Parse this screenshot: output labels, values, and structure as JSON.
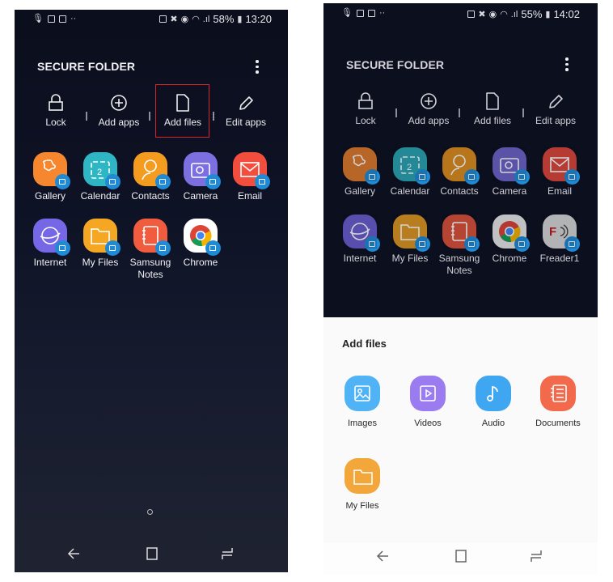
{
  "left_screen": {
    "status_bar": {
      "left_icons": [
        "mic-icon",
        "image-icon",
        "image-icon",
        "more-notifications-icon"
      ],
      "right_icons": [
        "battery-saver-icon",
        "mute-icon",
        "alarm-icon",
        "wifi-icon",
        "signal-icon"
      ],
      "battery": "58%",
      "time": "13:20"
    },
    "header": {
      "title": "SECURE FOLDER",
      "menu_icon": "more-vert-icon"
    },
    "actions": [
      {
        "label": "Lock",
        "icon": "lock-icon"
      },
      {
        "label": "Add apps",
        "icon": "add-circle-icon"
      },
      {
        "label": "Add files",
        "icon": "file-icon",
        "highlighted": true,
        "highlight_color": "#d7262a"
      },
      {
        "label": "Edit apps",
        "icon": "pencil-icon"
      }
    ],
    "apps": [
      {
        "label": "Gallery",
        "color": "#f7872f"
      },
      {
        "label": "Calendar",
        "color": "#2fb6c4"
      },
      {
        "label": "Contacts",
        "color": "#f39c1f"
      },
      {
        "label": "Camera",
        "color": "#7c6fe0"
      },
      {
        "label": "Email",
        "color": "#f24d3d"
      },
      {
        "label": "Internet",
        "color": "#7667e6"
      },
      {
        "label": "My Files",
        "color": "#f5a623"
      },
      {
        "label": "Samsung Notes",
        "color": "#f25c3e"
      },
      {
        "label": "Chrome",
        "color": "#ffffff"
      }
    ],
    "page_indicator": "home-page-indicator",
    "nav": [
      "back-icon",
      "home-icon",
      "recents-icon"
    ]
  },
  "right_screen": {
    "status_bar": {
      "left_icons": [
        "mic-icon",
        "email-icon",
        "image-icon",
        "more-notifications-icon"
      ],
      "right_icons": [
        "battery-saver-icon",
        "mute-icon",
        "alarm-icon",
        "wifi-icon",
        "signal-icon"
      ],
      "battery": "55%",
      "time": "14:02"
    },
    "header": {
      "title": "SECURE FOLDER",
      "menu_icon": "more-vert-icon"
    },
    "actions": [
      {
        "label": "Lock",
        "icon": "lock-icon"
      },
      {
        "label": "Add apps",
        "icon": "add-circle-icon"
      },
      {
        "label": "Add files",
        "icon": "file-icon"
      },
      {
        "label": "Edit apps",
        "icon": "pencil-icon"
      }
    ],
    "apps": [
      {
        "label": "Gallery",
        "color": "#e07a2c"
      },
      {
        "label": "Calendar",
        "color": "#2aa5b2"
      },
      {
        "label": "Contacts",
        "color": "#de8e1e"
      },
      {
        "label": "Camera",
        "color": "#6e63c9"
      },
      {
        "label": "Email",
        "color": "#dc463a"
      },
      {
        "label": "Internet",
        "color": "#6a5dcf"
      },
      {
        "label": "My Files",
        "color": "#de9722"
      },
      {
        "label": "Samsung Notes",
        "color": "#dc5239"
      },
      {
        "label": "Chrome",
        "color": "#e9e9e9"
      },
      {
        "label": "Freader1",
        "color": "#d8d8d8"
      }
    ],
    "sheet": {
      "title": "Add files",
      "items": [
        {
          "label": "Images",
          "color": "#4fb3f6"
        },
        {
          "label": "Videos",
          "color": "#9a7cf0"
        },
        {
          "label": "Audio",
          "color": "#3fa6f2"
        },
        {
          "label": "Documents",
          "color": "#f26a4b"
        },
        {
          "label": "My Files",
          "color": "#f3a63a"
        }
      ]
    },
    "nav": [
      "back-icon",
      "home-icon",
      "recents-icon"
    ]
  }
}
